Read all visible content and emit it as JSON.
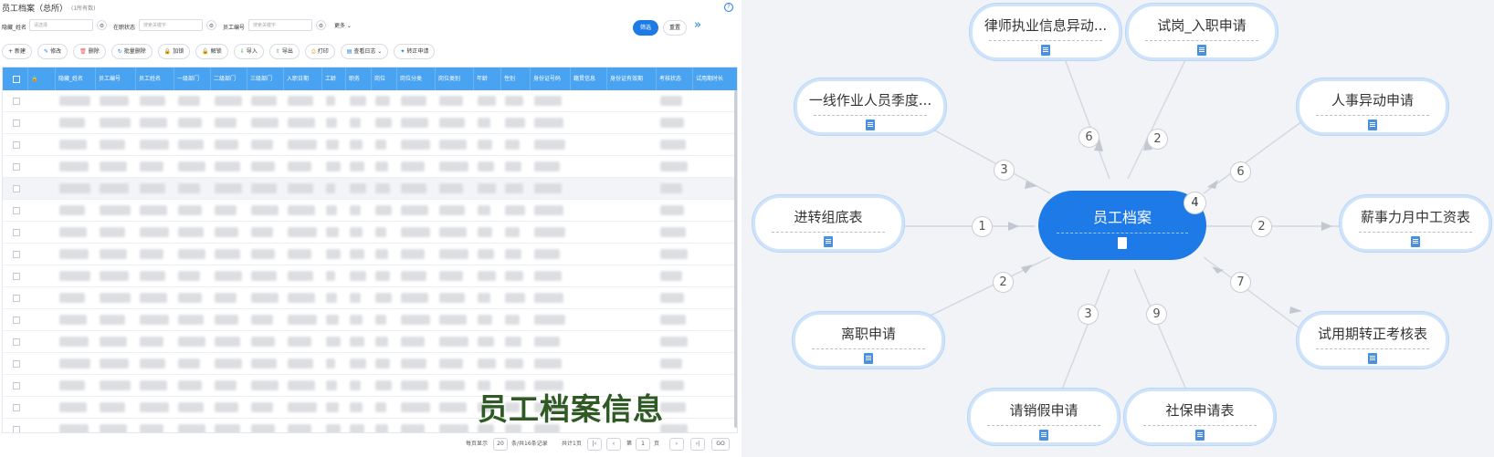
{
  "left_panel": {
    "title": "员工档案（总所）",
    "subtitle": "(1所有数)",
    "help_icon": "?",
    "filters": [
      {
        "label": "隐藏_姓名",
        "placeholder": "请选择"
      },
      {
        "label": "在职状态",
        "placeholder": "搜索关键字"
      },
      {
        "label": "员工编号",
        "placeholder": "搜索关键字"
      }
    ],
    "more_label": "更多 ⌄",
    "filter_button": "筛选",
    "reset_button": "重置",
    "collapse_icon": "»",
    "toolbar": [
      {
        "icon": "+",
        "label": "新建"
      },
      {
        "icon": "✎",
        "label": "修改"
      },
      {
        "icon": "🗑",
        "label": "删除"
      },
      {
        "icon": "↻",
        "label": "批量删除"
      },
      {
        "icon": "🔒",
        "label": "加锁"
      },
      {
        "icon": "🔓",
        "label": "解锁"
      },
      {
        "icon": "⇩",
        "label": "导入"
      },
      {
        "icon": "⇧",
        "label": "导出"
      },
      {
        "icon": "⎙",
        "label": "打印"
      },
      {
        "icon": "▤",
        "label": "查看日志 ⌄"
      },
      {
        "icon": "✦",
        "label": "转正申请"
      }
    ],
    "columns": [
      "",
      "",
      "隐藏_姓名",
      "员工编号",
      "员工姓名",
      "一级部门",
      "二级部门",
      "三级部门",
      "入职日期",
      "工龄",
      "职务",
      "岗位",
      "岗位分类",
      "岗位类别",
      "年龄",
      "性别",
      "身份证号码",
      "籍贯信息",
      "身份证有效期",
      "考核状态",
      "试用期时长"
    ],
    "row_count": 16,
    "watermark": "员工档案信息",
    "pager": {
      "per_page_label": "每页显示",
      "per_page": "20",
      "per_page_suffix": "条/共16条记录",
      "total_pages": "共计1页",
      "page_label": "第",
      "page": "1",
      "page_suffix": "页",
      "go": "GO"
    }
  },
  "mind_map": {
    "center": {
      "label": "员工档案",
      "badge": "4"
    },
    "nodes": [
      {
        "label": "律师执业信息异动...",
        "badge": "6"
      },
      {
        "label": "试岗_入职申请",
        "badge": "2"
      },
      {
        "label": "一线作业人员季度...",
        "badge": "3"
      },
      {
        "label": "人事异动申请",
        "badge": "6"
      },
      {
        "label": "进转组底表",
        "badge": "1"
      },
      {
        "label": "薪事力月中工资表",
        "badge": "2"
      },
      {
        "label": "离职申请",
        "badge": "2"
      },
      {
        "label": "试用期转正考核表",
        "badge": "7"
      },
      {
        "label": "请销假申请",
        "badge": "3"
      },
      {
        "label": "社保申请表",
        "badge": "9"
      }
    ]
  }
}
